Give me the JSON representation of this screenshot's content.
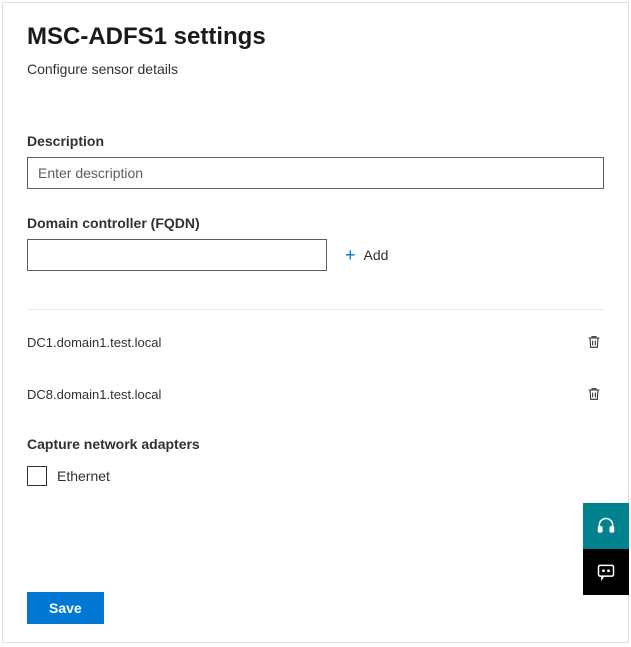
{
  "header": {
    "title": "MSC-ADFS1 settings",
    "subtitle": "Configure sensor details"
  },
  "description": {
    "label": "Description",
    "placeholder": "Enter description",
    "value": ""
  },
  "fqdn": {
    "label": "Domain controller (FQDN)",
    "value": "",
    "add_label": "Add"
  },
  "domain_controllers": [
    {
      "name": "DC1.domain1.test.local"
    },
    {
      "name": "DC8.domain1.test.local"
    }
  ],
  "adapters": {
    "label": "Capture network adapters",
    "items": [
      {
        "label": "Ethernet",
        "checked": false
      }
    ]
  },
  "actions": {
    "save": "Save"
  }
}
